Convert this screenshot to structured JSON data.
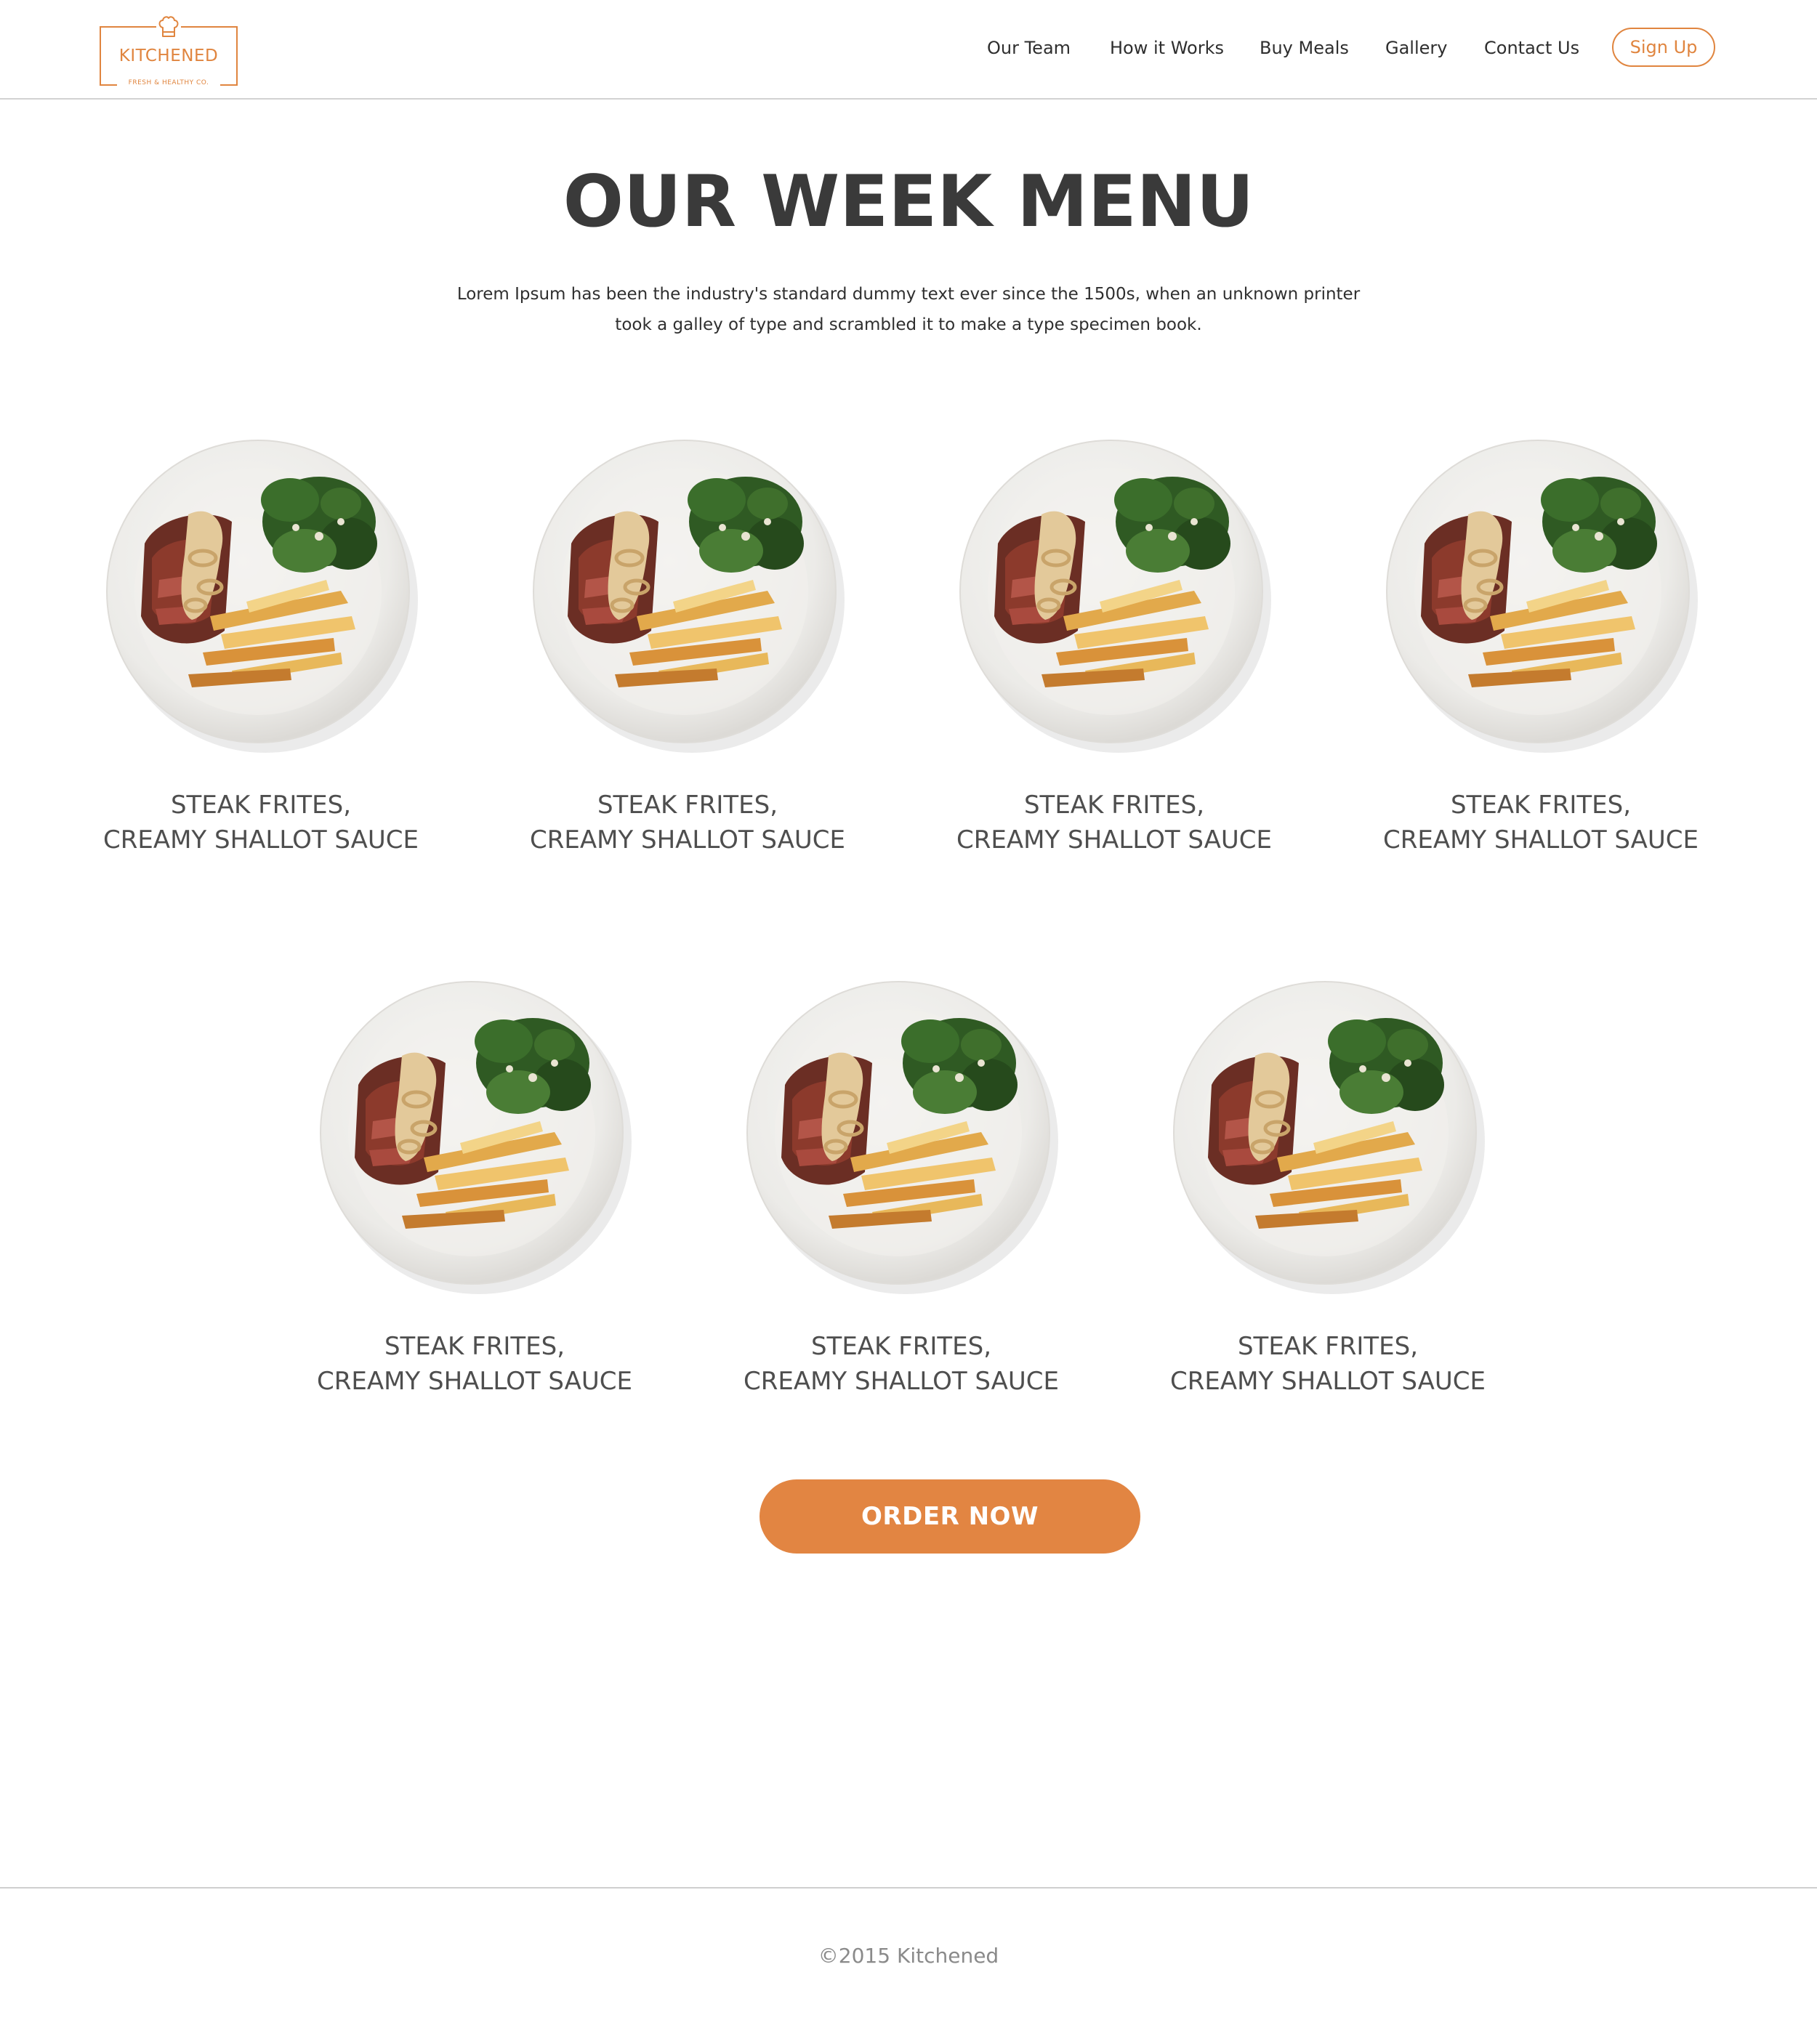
{
  "brand": {
    "name": "KITCHENED",
    "tagline": "FRESH & HEALTHY CO.",
    "accent_color": "#e0853f"
  },
  "nav": {
    "items": [
      "Our Team",
      "How it Works",
      "Buy Meals",
      "Gallery",
      "Contact Us"
    ],
    "signup_label": "Sign Up"
  },
  "main": {
    "title": "OUR WEEK MENU",
    "intro_line1": "Lorem Ipsum has been the industry's standard dummy text ever since the 1500s, when an unknown printer",
    "intro_line2": "took a galley of type and scrambled it to make a type specimen book.",
    "meals": [
      {
        "name": "STEAK FRITES,\nCREAMY SHALLOT SAUCE",
        "image": "steak-frites-plate"
      },
      {
        "name": "STEAK FRITES,\nCREAMY SHALLOT SAUCE",
        "image": "steak-frites-plate"
      },
      {
        "name": "STEAK FRITES,\nCREAMY SHALLOT SAUCE",
        "image": "steak-frites-plate"
      },
      {
        "name": "STEAK FRITES,\nCREAMY SHALLOT SAUCE",
        "image": "steak-frites-plate"
      },
      {
        "name": "STEAK FRITES,\nCREAMY SHALLOT SAUCE",
        "image": "steak-frites-plate"
      },
      {
        "name": "STEAK FRITES,\nCREAMY SHALLOT SAUCE",
        "image": "steak-frites-plate"
      },
      {
        "name": "STEAK FRITES,\nCREAMY SHALLOT SAUCE",
        "image": "steak-frites-plate"
      }
    ],
    "order_label": "ORDER NOW",
    "order_color": "#e28542"
  },
  "footer": {
    "copyright": "©2015 Kitchened"
  }
}
